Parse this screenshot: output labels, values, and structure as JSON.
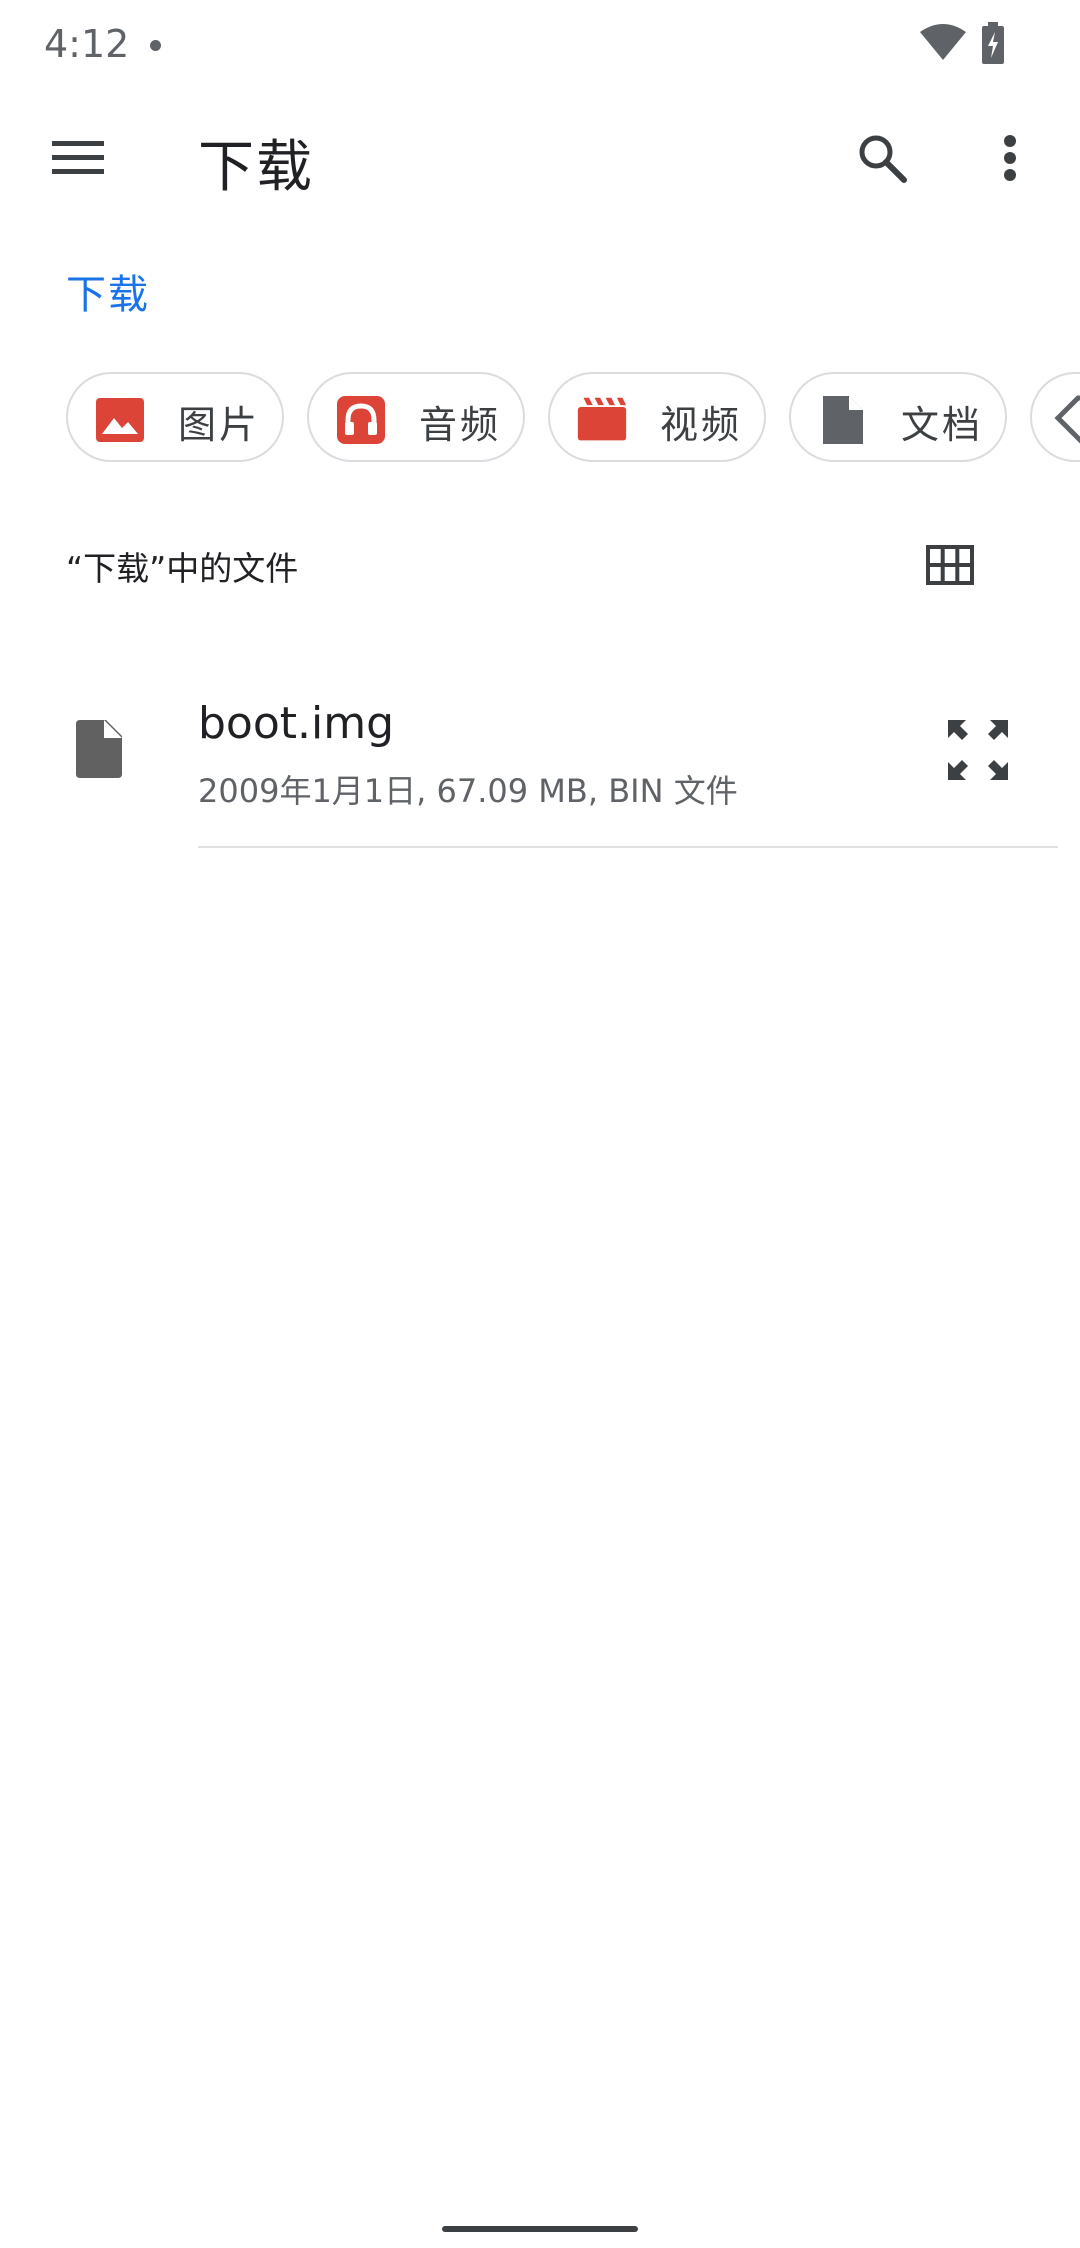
{
  "status_bar": {
    "time": "4:12",
    "icons": [
      "notification-dot-icon",
      "wifi-icon",
      "battery-charging-icon"
    ]
  },
  "app_bar": {
    "title": "下载",
    "left_icon": "menu-icon",
    "right_icons": [
      "search-icon",
      "more-vert-icon"
    ]
  },
  "breadcrumb": {
    "label": "下载"
  },
  "chips": [
    {
      "label": "图片",
      "icon": "image-icon",
      "color": "#db4437"
    },
    {
      "label": "音频",
      "icon": "headphones-icon",
      "color": "#db4437"
    },
    {
      "label": "视频",
      "icon": "movie-icon",
      "color": "#db4437"
    },
    {
      "label": "文档",
      "icon": "document-icon",
      "color": "#5f6368"
    },
    {
      "label": "",
      "icon": "label-icon",
      "color": "#5f6368"
    }
  ],
  "section": {
    "title": "“下载”中的文件",
    "view_toggle_icon": "grid-view-icon"
  },
  "files": [
    {
      "name": "boot.img",
      "meta": "2009年1月1日, 67.09 MB, BIN 文件",
      "icon": "file-icon",
      "action_icon": "expand-icon"
    }
  ],
  "colors": {
    "accent": "#1a73e8",
    "chip_icon_red": "#db4437",
    "icon_gray": "#5f6368",
    "text_primary": "#202124",
    "chip_border": "#dadce0"
  }
}
